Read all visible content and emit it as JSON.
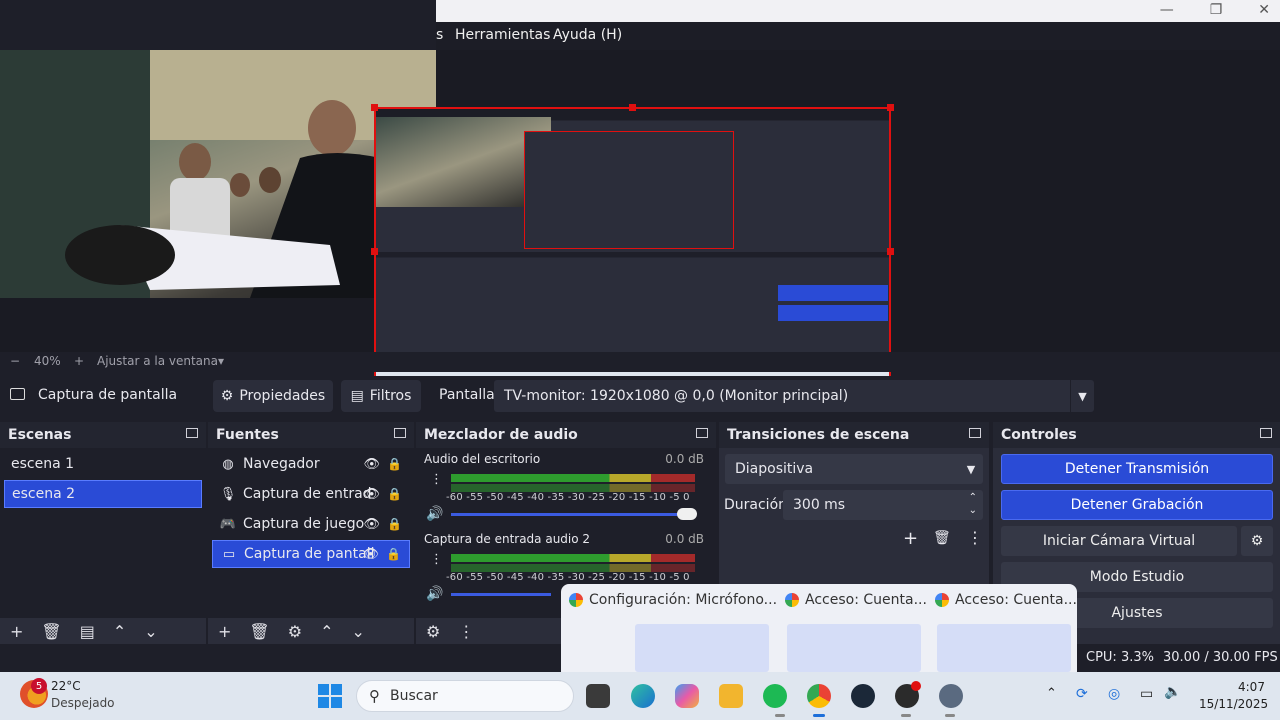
{
  "menu": {
    "items": [
      "s",
      "Herramientas",
      "Ayuda (H)"
    ]
  },
  "window": {
    "min": "—",
    "max": "❐",
    "close": "✕"
  },
  "zoom": {
    "minus": "−",
    "level": "40%",
    "plus": "+",
    "fit": "Ajustar a la ventana",
    "caret": "▾"
  },
  "source_toolbar": {
    "source_name": "Captura de pantalla",
    "properties": "Propiedades",
    "filters": "Filtros",
    "display_label": "Pantalla",
    "display_value": "TV-monitor: 1920x1080 @ 0,0 (Monitor principal)"
  },
  "scenes": {
    "title": "Escenas",
    "items": [
      "escena 1",
      "escena 2"
    ],
    "selected": 1
  },
  "sources": {
    "title": "Fuentes",
    "items": [
      {
        "label": "Navegador",
        "icon": "globe-icon"
      },
      {
        "label": "Captura de entrad",
        "icon": "microphone-icon"
      },
      {
        "label": "Captura de juego",
        "icon": "gamepad-icon"
      },
      {
        "label": "Captura de pantall",
        "icon": "monitor-icon"
      }
    ],
    "selected": 3
  },
  "mixer": {
    "title": "Mezclador de audio",
    "ticks": "-60 -55 -50 -45 -40 -35 -30 -25 -20 -15 -10  -5   0",
    "channels": [
      {
        "name": "Audio del escritorio",
        "db": "0.0 dB",
        "volume": 1.0
      },
      {
        "name": "Captura de entrada audio 2",
        "db": "0.0 dB",
        "volume": 1.0
      }
    ]
  },
  "transitions": {
    "title": "Transiciones de escena",
    "type": "Diapositiva",
    "duration_label": "Duración",
    "duration_value": "300 ms"
  },
  "controls": {
    "title": "Controles",
    "stop_stream": "Detener Transmisión",
    "stop_record": "Detener Grabación",
    "virtual_cam": "Iniciar Cámara Virtual",
    "studio_mode": "Modo Estudio",
    "settings": "Ajustes"
  },
  "status": {
    "cpu": "CPU: 3.3%",
    "fps": "30.00 / 30.00 FPS"
  },
  "chrome_popup": {
    "tabs": [
      "Configuración: Micrófono...",
      "Acceso: Cuenta...",
      "Acceso: Cuenta..."
    ]
  },
  "taskbar": {
    "weather_temp": "22°C",
    "weather_desc": "Despejado",
    "weather_badge": "5",
    "search_placeholder": "Buscar",
    "time": "4:07",
    "date": "15/11/2025"
  },
  "colors": {
    "accent": "#2a4bd6",
    "selection_red": "#e01010"
  }
}
